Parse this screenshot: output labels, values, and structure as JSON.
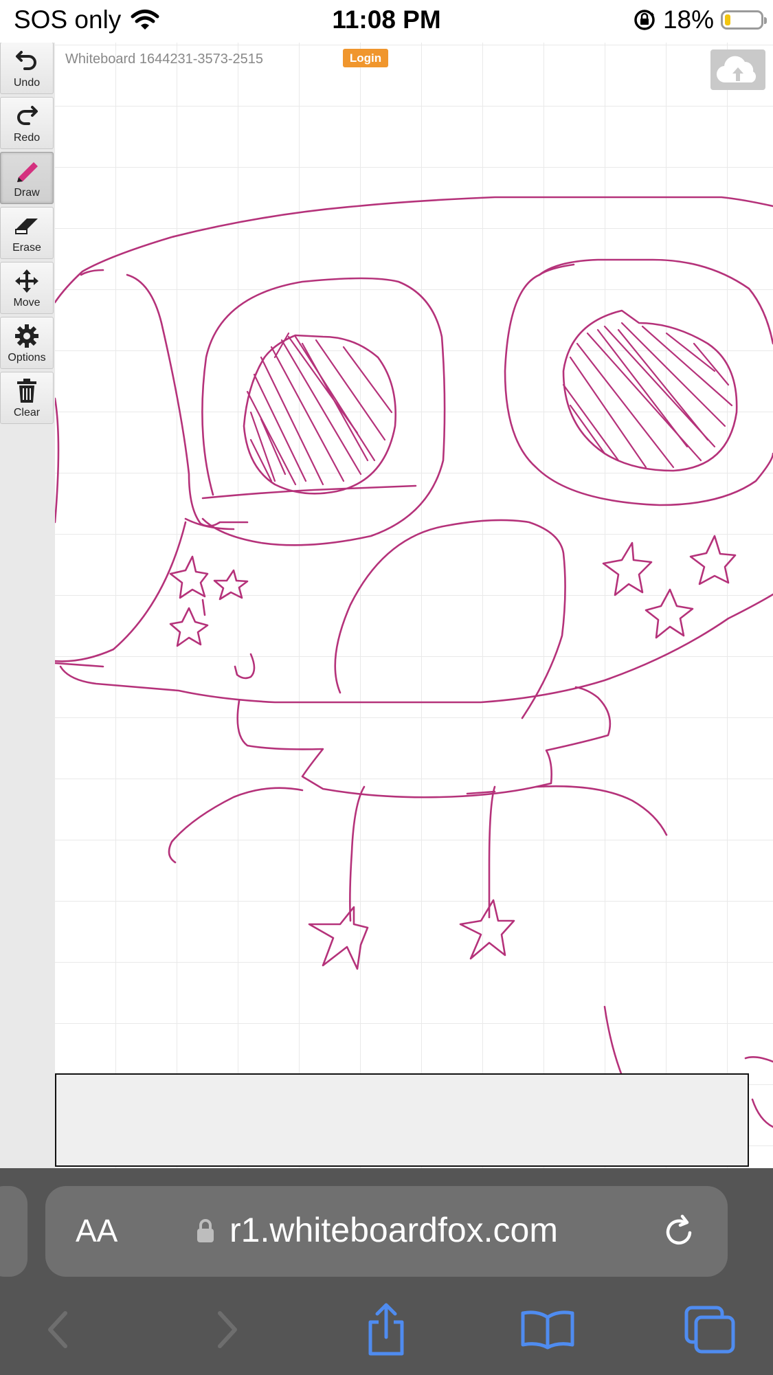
{
  "status_bar": {
    "carrier": "SOS only",
    "time": "11:08 PM",
    "battery": "18%"
  },
  "whiteboard": {
    "title": "Whiteboard 1644231-3573-2515",
    "login_label": "Login",
    "upload_icon": "cloud-upload-icon",
    "stroke_color": "#b5327a"
  },
  "toolbar": {
    "items": [
      {
        "label": "Undo",
        "icon": "undo-icon"
      },
      {
        "label": "Redo",
        "icon": "redo-icon"
      },
      {
        "label": "Draw",
        "icon": "pencil-icon",
        "active": true
      },
      {
        "label": "Erase",
        "icon": "eraser-icon"
      },
      {
        "label": "Move",
        "icon": "move-icon"
      },
      {
        "label": "Options",
        "icon": "gear-icon"
      },
      {
        "label": "Clear",
        "icon": "trash-icon"
      }
    ]
  },
  "browser": {
    "text_size_label": "AA",
    "url": "r1.whiteboardfox.com",
    "nav": [
      "back-icon",
      "forward-icon",
      "share-icon",
      "bookmarks-icon",
      "tabs-icon"
    ]
  },
  "colors": {
    "accent_login": "#f0962d",
    "ios_blue": "#4f8cf0"
  }
}
